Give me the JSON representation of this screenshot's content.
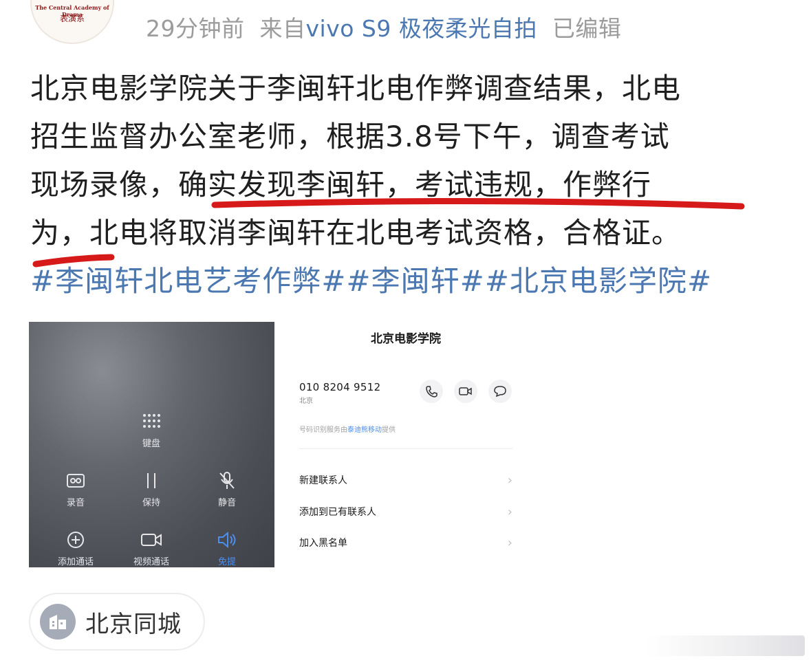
{
  "header": {
    "avatar_org": "The Central Academy of Drama",
    "avatar_seal": "表演系",
    "time": "29分钟前",
    "from_prefix": "来自",
    "device": "vivo S9 极夜柔光自拍",
    "edited": "已编辑"
  },
  "post": {
    "lines": [
      "北京电影学院关于李闽轩北电作弊调查结果，北电",
      "招生监督办公室老师，根据3.8号下午，调查考试",
      "现场录像，确实发现李闽轩，考试违规，作弊行",
      "为，北电将取消李闽轩在北电考试资格，合格证。"
    ],
    "hashtags": "#李闽轩北电艺考作弊##李闽轩##北京电影学院#",
    "underline_color": "#d61a1a"
  },
  "call_screen": {
    "keypad": "键盘",
    "record": "录音",
    "hold": "保持",
    "mute": "静音",
    "add_call": "添加通话",
    "video_call": "视频通话",
    "speaker": "免提"
  },
  "contact_card": {
    "name": "北京电影学院",
    "number": "010 8204 9512",
    "location": "北京",
    "provider_prefix": "号码识别服务由",
    "provider_brand": "泰迪熊移动",
    "provider_suffix": "提供",
    "actions": [
      "新建联系人",
      "添加到已有联系人",
      "加入黑名单"
    ]
  },
  "location_chip": {
    "label": "北京同城"
  },
  "colors": {
    "link": "#4c78b1",
    "meta_gray": "#9c9c9c",
    "accent_blue": "#4c8ff0"
  }
}
